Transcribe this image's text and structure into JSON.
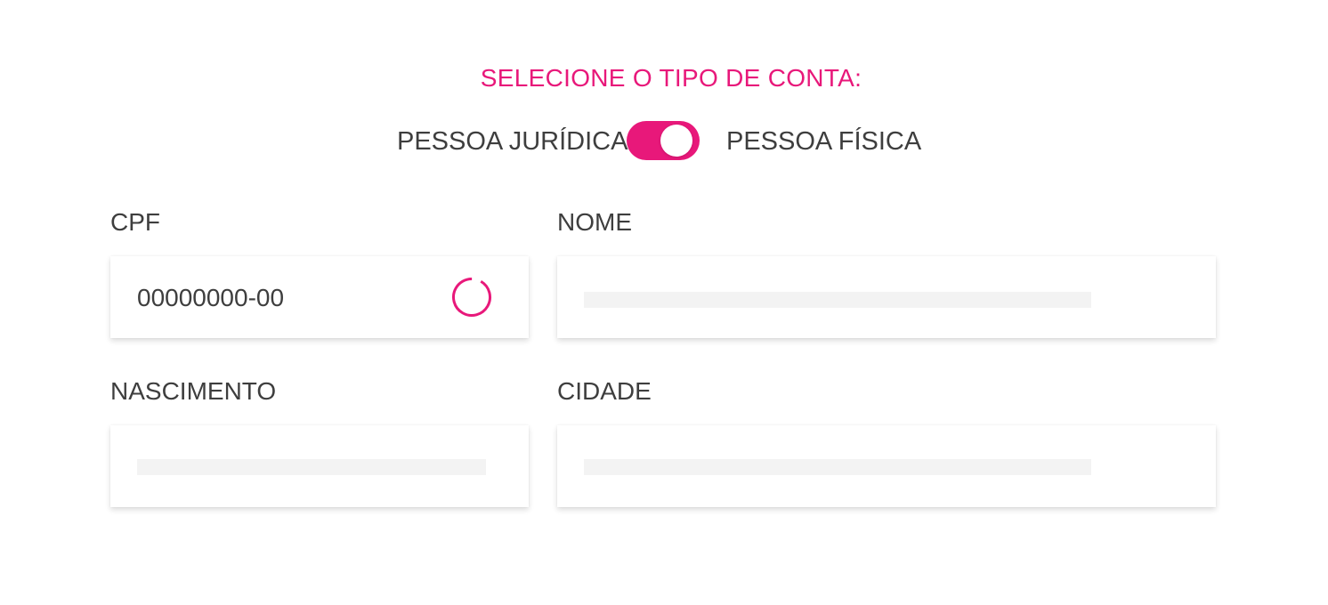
{
  "header": {
    "title": "SELECIONE O TIPO DE CONTA:"
  },
  "account_type": {
    "left_label": "PESSOA JURÍDICA",
    "right_label": "PESSOA FÍSICA",
    "selected": "PESSOA FÍSICA"
  },
  "fields": {
    "cpf": {
      "label": "CPF",
      "value": "00000000-00",
      "status": "loading"
    },
    "nome": {
      "label": "NOME",
      "value": ""
    },
    "nascimento": {
      "label": "NASCIMENTO",
      "value": ""
    },
    "cidade": {
      "label": "CIDADE",
      "value": ""
    }
  },
  "colors": {
    "accent": "#e8187a",
    "text": "#3e3e3e",
    "skeleton": "#f3f3f3"
  },
  "icons": {
    "loading": "loading-spinner-icon"
  }
}
